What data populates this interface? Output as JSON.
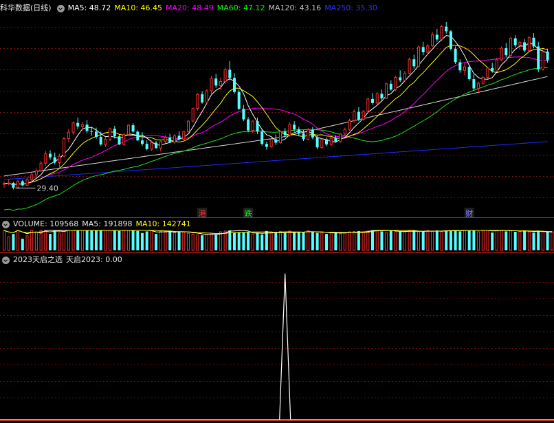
{
  "header_main": {
    "title": "科华数据(日线)",
    "ma": [
      {
        "label": "MA5: 48.72",
        "color": "#ffffff"
      },
      {
        "label": "MA10: 46.45",
        "color": "#ffff00"
      },
      {
        "label": "MA20: 48.49",
        "color": "#ff00ff"
      },
      {
        "label": "MA60: 47.12",
        "color": "#00ff00"
      },
      {
        "label": "MA120: 43.16",
        "color": "#c0c0c0"
      },
      {
        "label": "MA250: 35.30",
        "color": "#3030ff"
      }
    ]
  },
  "header_volume": {
    "label": "VOLUME: 109568",
    "ma5": "MA5: 191898",
    "ma10": "MA10: 142741"
  },
  "header_indicator": {
    "name": "2023天启之选",
    "value": "天启2023: 0.00"
  },
  "chart_data": [
    {
      "type": "candlestick",
      "title": "科华数据(日线)",
      "price_range": [
        25,
        58
      ],
      "low_label": "29.40",
      "up_color": "#ff3030",
      "down_color": "#54ffff",
      "candles": [
        [
          28.8,
          29.3,
          28.2,
          28.9
        ],
        [
          28.9,
          29.6,
          28.6,
          29.0
        ],
        [
          29.0,
          29.2,
          27.9,
          28.2
        ],
        [
          28.2,
          29.6,
          28.0,
          29.3
        ],
        [
          29.3,
          29.5,
          28.4,
          28.6
        ],
        [
          28.6,
          29.9,
          28.5,
          29.6
        ],
        [
          29.6,
          30.8,
          29.2,
          30.4
        ],
        [
          30.4,
          31.5,
          30.0,
          31.1
        ],
        [
          31.1,
          32.8,
          30.9,
          32.4
        ],
        [
          32.4,
          34.5,
          32.0,
          34.0
        ],
        [
          34.0,
          34.6,
          33.0,
          33.4
        ],
        [
          33.4,
          34.2,
          32.2,
          32.5
        ],
        [
          32.5,
          34.0,
          31.6,
          33.6
        ],
        [
          33.6,
          36.9,
          33.4,
          36.6
        ],
        [
          36.6,
          38.3,
          36.0,
          37.7
        ],
        [
          37.7,
          39.6,
          37.2,
          39.3
        ],
        [
          39.3,
          40.2,
          38.2,
          38.7
        ],
        [
          38.7,
          39.5,
          38.0,
          39.0
        ],
        [
          39.0,
          39.8,
          37.6,
          37.9
        ],
        [
          37.9,
          38.6,
          37.1,
          37.8
        ],
        [
          37.8,
          38.5,
          36.6,
          36.9
        ],
        [
          36.9,
          37.8,
          35.4,
          35.6
        ],
        [
          35.6,
          36.9,
          35.2,
          36.5
        ],
        [
          36.5,
          38.5,
          36.2,
          38.3
        ],
        [
          38.3,
          38.8,
          36.6,
          37.0
        ],
        [
          37.0,
          37.3,
          35.5,
          35.6
        ],
        [
          35.6,
          37.5,
          35.4,
          37.3
        ],
        [
          37.3,
          39.1,
          37.1,
          38.9
        ],
        [
          38.9,
          39.3,
          37.6,
          37.8
        ],
        [
          37.8,
          38.0,
          36.2,
          36.3
        ],
        [
          36.3,
          37.7,
          35.4,
          35.7
        ],
        [
          35.7,
          36.3,
          34.6,
          34.8
        ],
        [
          34.8,
          36.3,
          34.5,
          35.9
        ],
        [
          35.9,
          36.2,
          34.8,
          35.0
        ],
        [
          35.0,
          36.2,
          34.4,
          36.1
        ],
        [
          36.1,
          37.2,
          35.8,
          36.8
        ],
        [
          36.8,
          37.4,
          35.8,
          36.0
        ],
        [
          36.0,
          37.4,
          35.7,
          37.1
        ],
        [
          37.1,
          37.9,
          36.3,
          36.5
        ],
        [
          36.5,
          37.9,
          36.3,
          37.8
        ],
        [
          37.8,
          39.8,
          37.6,
          39.6
        ],
        [
          39.6,
          41.9,
          39.4,
          41.8
        ],
        [
          41.8,
          44.4,
          41.4,
          44.2
        ],
        [
          44.2,
          44.7,
          42.6,
          42.8
        ],
        [
          42.8,
          45.1,
          42.6,
          44.8
        ],
        [
          44.8,
          47.3,
          44.2,
          46.9
        ],
        [
          46.9,
          47.7,
          45.3,
          45.7
        ],
        [
          45.7,
          47.1,
          45.0,
          46.4
        ],
        [
          46.4,
          48.8,
          46.0,
          48.4
        ],
        [
          48.4,
          49.9,
          46.6,
          47.0
        ],
        [
          47.0,
          47.8,
          44.3,
          44.6
        ],
        [
          44.6,
          45.0,
          41.5,
          41.7
        ],
        [
          41.7,
          42.4,
          39.6,
          39.9
        ],
        [
          39.9,
          40.3,
          37.7,
          38.0
        ],
        [
          38.0,
          39.8,
          37.6,
          39.6
        ],
        [
          39.6,
          40.2,
          37.4,
          37.8
        ],
        [
          37.8,
          38.2,
          35.4,
          35.7
        ],
        [
          35.7,
          36.1,
          34.7,
          35.2
        ],
        [
          35.2,
          36.9,
          35.0,
          36.5
        ],
        [
          36.5,
          37.3,
          35.5,
          35.9
        ],
        [
          35.9,
          38.0,
          35.7,
          37.8
        ],
        [
          37.8,
          38.4,
          36.8,
          37.2
        ],
        [
          37.2,
          39.4,
          36.9,
          39.0
        ],
        [
          39.0,
          39.6,
          37.8,
          38.2
        ],
        [
          38.2,
          38.6,
          37.0,
          37.5
        ],
        [
          37.5,
          38.1,
          36.2,
          36.5
        ],
        [
          36.5,
          38.4,
          36.3,
          38.1
        ],
        [
          38.1,
          38.6,
          36.5,
          36.8
        ],
        [
          36.8,
          37.1,
          34.8,
          35.1
        ],
        [
          35.1,
          36.7,
          34.9,
          36.5
        ],
        [
          36.5,
          36.8,
          35.3,
          35.6
        ],
        [
          35.6,
          36.9,
          35.3,
          36.7
        ],
        [
          36.7,
          37.2,
          35.9,
          36.1
        ],
        [
          36.1,
          37.6,
          35.9,
          37.4
        ],
        [
          37.4,
          38.5,
          37.2,
          38.2
        ],
        [
          38.2,
          40.0,
          37.9,
          39.7
        ],
        [
          39.7,
          41.6,
          39.3,
          41.2
        ],
        [
          41.2,
          42.0,
          39.6,
          39.9
        ],
        [
          39.9,
          41.5,
          39.7,
          41.3
        ],
        [
          41.3,
          43.6,
          41.0,
          43.4
        ],
        [
          43.4,
          44.4,
          42.4,
          42.7
        ],
        [
          42.7,
          44.6,
          42.5,
          44.3
        ],
        [
          44.3,
          45.0,
          43.2,
          43.5
        ],
        [
          43.5,
          46.2,
          43.4,
          46.0
        ],
        [
          46.0,
          46.6,
          44.8,
          45.0
        ],
        [
          45.0,
          47.4,
          44.8,
          47.1
        ],
        [
          47.1,
          48.3,
          46.3,
          46.6
        ],
        [
          46.6,
          48.2,
          46.4,
          47.8
        ],
        [
          47.8,
          50.5,
          47.6,
          50.2
        ],
        [
          50.2,
          51.0,
          48.6,
          49.0
        ],
        [
          49.0,
          52.6,
          48.8,
          52.3
        ],
        [
          52.3,
          53.2,
          50.9,
          51.4
        ],
        [
          51.4,
          52.8,
          51.0,
          52.5
        ],
        [
          52.5,
          54.9,
          52.3,
          54.4
        ],
        [
          54.4,
          55.4,
          53.2,
          53.6
        ],
        [
          53.6,
          56.1,
          53.3,
          55.8
        ],
        [
          55.8,
          56.6,
          54.6,
          55.0
        ],
        [
          55.0,
          55.2,
          51.7,
          52.0
        ],
        [
          52.0,
          52.4,
          49.4,
          49.7
        ],
        [
          49.7,
          50.2,
          47.9,
          48.3
        ],
        [
          48.3,
          49.6,
          47.5,
          48.9
        ],
        [
          48.9,
          49.3,
          46.5,
          46.8
        ],
        [
          46.8,
          47.6,
          44.8,
          45.2
        ],
        [
          45.2,
          46.4,
          44.3,
          46.1
        ],
        [
          46.1,
          47.4,
          45.8,
          47.1
        ],
        [
          47.1,
          48.9,
          46.9,
          48.7
        ],
        [
          48.7,
          49.6,
          47.9,
          48.2
        ],
        [
          48.2,
          50.5,
          48.0,
          50.1
        ],
        [
          50.1,
          52.4,
          49.9,
          52.1
        ],
        [
          52.1,
          53.0,
          50.6,
          50.9
        ],
        [
          50.9,
          54.1,
          50.6,
          53.8
        ],
        [
          53.8,
          54.3,
          52.2,
          52.6
        ],
        [
          52.6,
          53.4,
          51.8,
          53.1
        ],
        [
          53.1,
          53.7,
          51.4,
          51.7
        ],
        [
          51.7,
          54.2,
          51.5,
          53.9
        ],
        [
          53.9,
          54.7,
          52.1,
          52.4
        ],
        [
          52.4,
          53.2,
          48.0,
          48.5
        ],
        [
          48.5,
          51.8,
          48.2,
          51.5
        ],
        [
          51.5,
          52.0,
          49.6,
          50.0
        ]
      ]
    },
    {
      "type": "bar",
      "title": "VOLUME",
      "up_color": "#ff3030",
      "down_color": "#54ffff",
      "values": [
        120,
        70,
        85,
        140,
        60,
        75,
        105,
        95,
        110,
        130,
        85,
        105,
        90,
        120,
        160,
        225,
        255,
        175,
        145,
        110,
        130,
        150,
        125,
        105,
        120,
        100,
        110,
        112,
        115,
        100,
        90,
        98,
        105,
        85,
        98,
        94,
        102,
        92,
        98,
        96,
        88,
        84,
        80,
        78,
        84,
        88,
        80,
        96,
        100,
        136,
        90,
        92,
        92,
        94,
        82,
        90,
        82,
        100,
        95,
        96,
        98,
        90,
        100,
        92,
        95,
        94,
        102,
        98,
        90,
        92,
        85,
        90,
        95,
        88,
        92,
        96,
        98,
        100,
        92,
        100,
        138,
        110,
        98,
        92,
        105,
        98,
        96,
        96,
        100,
        104,
        96,
        98,
        102,
        98,
        104,
        98,
        104,
        108,
        104,
        98,
        110,
        104,
        108,
        96,
        102,
        106,
        92,
        110,
        104,
        98,
        102,
        96,
        98,
        106,
        96,
        92,
        100,
        96,
        94,
        95
      ],
      "ylim": [
        0,
        330
      ]
    },
    {
      "type": "line",
      "title": "2023天启之选",
      "series_name": "天启2023",
      "values_note_value": 0.0,
      "signal_index": 61,
      "signal_value": 1.0,
      "ylim": [
        0,
        1.05
      ]
    }
  ],
  "event_markers": [
    {
      "text": "港",
      "color": "#ff3030",
      "index": 43
    },
    {
      "text": "跌",
      "color": "#00ff00",
      "index": 53
    },
    {
      "text": "财",
      "color": "#8080ff",
      "index": 101
    }
  ]
}
